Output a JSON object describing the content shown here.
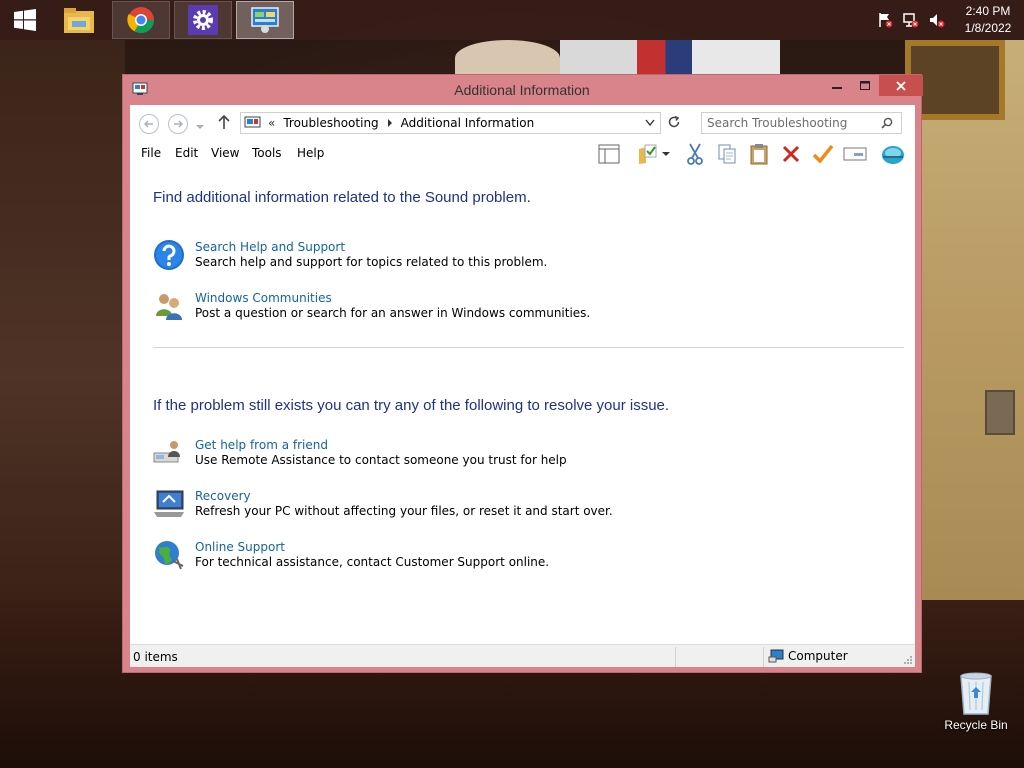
{
  "taskbar": {
    "apps": [
      {
        "name": "File Explorer",
        "icon": "file-explorer-icon"
      },
      {
        "name": "Google Chrome",
        "icon": "chrome-icon"
      },
      {
        "name": "Settings",
        "icon": "settings-gear-icon"
      },
      {
        "name": "Control Panel",
        "icon": "control-panel-icon"
      }
    ],
    "clock": {
      "time": "2:40 PM",
      "date": "1/8/2022"
    }
  },
  "window": {
    "title": "Additional Information",
    "address": {
      "overflow": "«",
      "crumbs": [
        "Troubleshooting",
        "Additional Information"
      ]
    },
    "search_placeholder": "Search Troubleshooting",
    "menu": [
      "File",
      "Edit",
      "View",
      "Tools",
      "Help"
    ],
    "section1": {
      "heading": "Find additional information related to the Sound problem.",
      "tasks": [
        {
          "link": "Search Help and Support",
          "desc": "Search help and support for topics related to this problem.",
          "icon": "help-question-icon"
        },
        {
          "link": "Windows Communities",
          "desc": "Post a question or search for an answer in Windows communities.",
          "icon": "communities-people-icon"
        }
      ]
    },
    "section2": {
      "heading": "If the problem still exists you can try any of the following to resolve your issue.",
      "tasks": [
        {
          "link": "Get help from a friend",
          "desc": "Use Remote Assistance to contact someone you trust for help",
          "icon": "remote-assistance-icon"
        },
        {
          "link": "Recovery",
          "desc": "Refresh your PC without affecting your files, or reset it and start over.",
          "icon": "recovery-computer-icon"
        },
        {
          "link": "Online Support",
          "desc": "For technical assistance, contact Customer Support online.",
          "icon": "online-support-globe-icon"
        }
      ]
    },
    "status": {
      "items": "0 items",
      "location": "Computer"
    }
  },
  "desktop": {
    "recycle_bin": "Recycle Bin"
  },
  "colors": {
    "window_frame": "#d9848a",
    "close_button": "#c7504f",
    "heading": "#1e3287",
    "link": "#1464a0"
  }
}
